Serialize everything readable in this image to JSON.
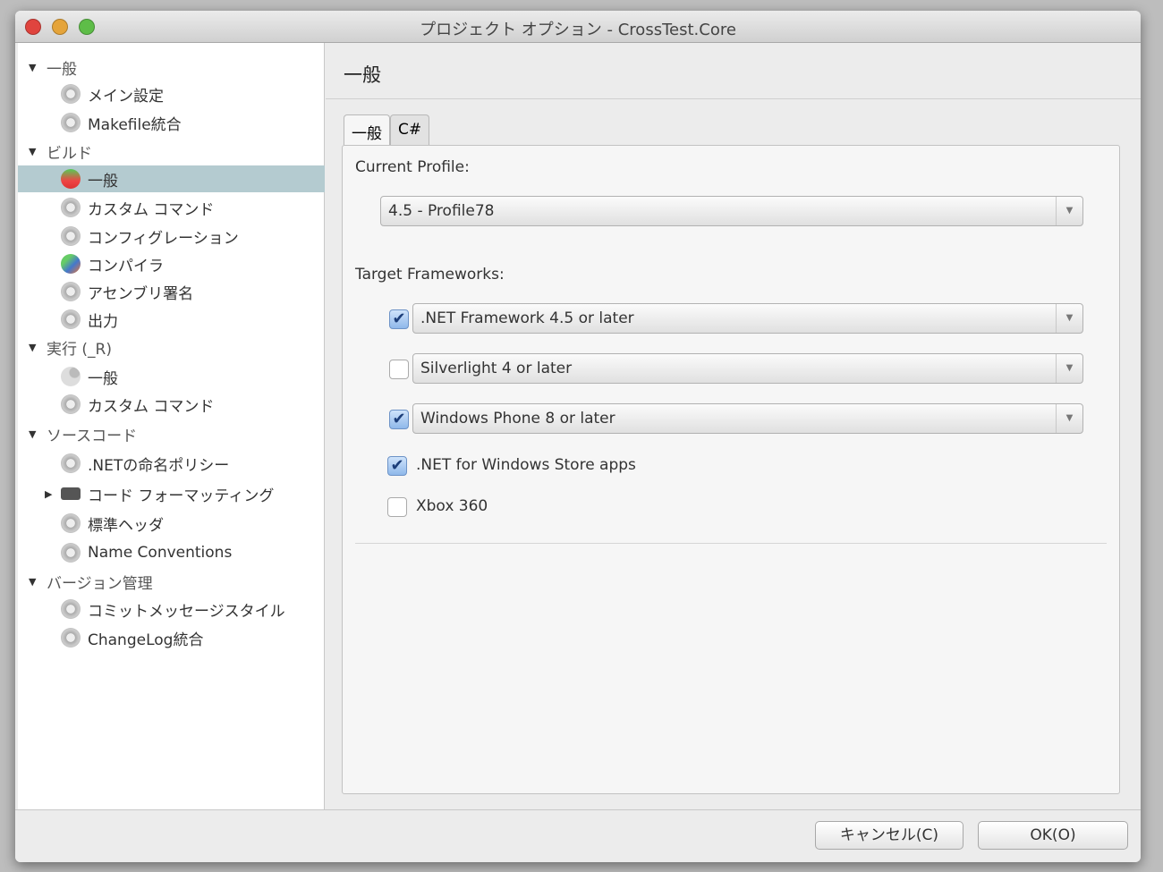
{
  "window": {
    "title": "プロジェクト オプション - CrossTest.Core"
  },
  "sidebar": {
    "items": [
      {
        "label": "一般",
        "level": 0,
        "expander": "▼",
        "icon": "none"
      },
      {
        "label": "メイン設定",
        "level": 1,
        "icon": "gear-icon"
      },
      {
        "label": "Makefile統合",
        "level": 1,
        "icon": "gear-icon"
      },
      {
        "label": "ビルド",
        "level": 0,
        "expander": "▼",
        "icon": "none"
      },
      {
        "label": "一般",
        "level": 1,
        "icon": "build-icon",
        "selected": true
      },
      {
        "label": "カスタム コマンド",
        "level": 1,
        "icon": "gear-icon"
      },
      {
        "label": "コンフィグレーション",
        "level": 1,
        "icon": "gear-icon"
      },
      {
        "label": "コンパイラ",
        "level": 1,
        "icon": "compiler-icon"
      },
      {
        "label": "アセンブリ署名",
        "level": 1,
        "icon": "gear-icon"
      },
      {
        "label": "出力",
        "level": 1,
        "icon": "gear-icon"
      },
      {
        "label": "実行 (_R)",
        "level": 0,
        "expander": "▼",
        "icon": "none"
      },
      {
        "label": "一般",
        "level": 1,
        "icon": "run-icon"
      },
      {
        "label": "カスタム コマンド",
        "level": 1,
        "icon": "gear-icon"
      },
      {
        "label": "ソースコード",
        "level": 0,
        "expander": "▼",
        "icon": "none"
      },
      {
        "label": ".NETの命名ポリシー",
        "level": 1,
        "icon": "gear-icon"
      },
      {
        "label": "コード フォーマッティング",
        "level": 1,
        "expander": "▶",
        "icon": "code-format-icon"
      },
      {
        "label": "標準ヘッダ",
        "level": 1,
        "icon": "gear-icon"
      },
      {
        "label": "Name Conventions",
        "level": 1,
        "icon": "gear-icon"
      },
      {
        "label": "バージョン管理",
        "level": 0,
        "expander": "▼",
        "icon": "none"
      },
      {
        "label": "コミットメッセージスタイル",
        "level": 1,
        "icon": "gear-icon"
      },
      {
        "label": "ChangeLog統合",
        "level": 1,
        "icon": "gear-icon"
      }
    ]
  },
  "main": {
    "header": "一般",
    "tabs": [
      {
        "label": "一般",
        "active": true
      },
      {
        "label": "C#",
        "active": false
      }
    ],
    "current_profile_label": "Current Profile:",
    "current_profile_value": "4.5 - Profile78",
    "target_frameworks_label": "Target Frameworks:",
    "frameworks": [
      {
        "label": ".NET Framework 4.5 or later",
        "checked": true,
        "dropdown": true
      },
      {
        "label": "Silverlight 4 or later",
        "checked": false,
        "dropdown": true
      },
      {
        "label": "Windows Phone 8 or later",
        "checked": true,
        "dropdown": true
      },
      {
        "label": ".NET for Windows Store apps",
        "checked": true,
        "dropdown": false
      },
      {
        "label": "Xbox 360",
        "checked": false,
        "dropdown": false
      }
    ]
  },
  "footer": {
    "cancel": "キャンセル(C)",
    "ok": "OK(O)"
  },
  "colors": {
    "selection": "#b4cbd0",
    "close": "#e0443e",
    "minimize": "#e5a43a",
    "zoom": "#5ebd48"
  }
}
